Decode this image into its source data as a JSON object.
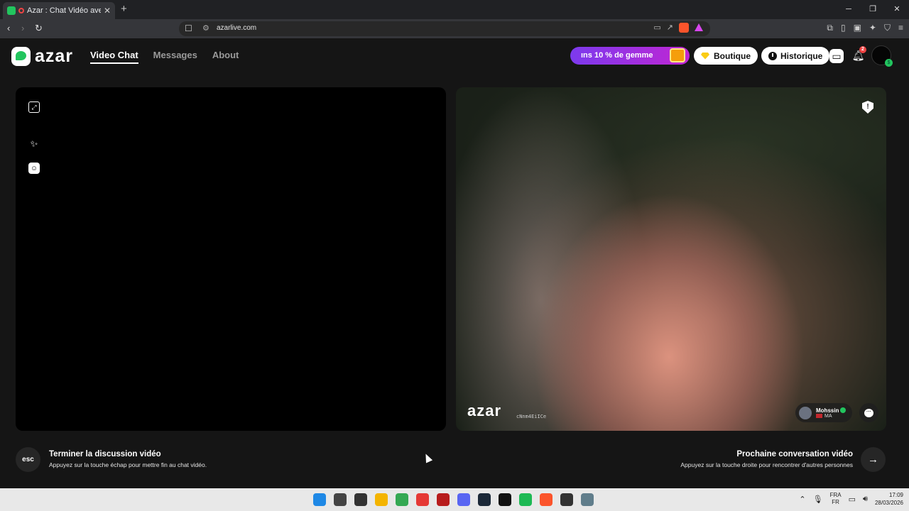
{
  "browser": {
    "tab_title": "Azar : Chat Vidéo avec de no",
    "tab_close": "✕",
    "new_tab": "+",
    "url": "azarlive.com",
    "window_controls": [
      "─",
      "❐",
      "✕"
    ]
  },
  "header": {
    "logo_text": "azar",
    "nav": [
      {
        "label": "Video Chat",
        "active": true
      },
      {
        "label": "Messages",
        "active": false
      },
      {
        "label": "About",
        "active": false
      }
    ],
    "promo_text": "ıns 10 % de gemme",
    "shop_label": "Boutique",
    "history_label": "Historique",
    "notification_count": "2",
    "avatar_badge": "$"
  },
  "remote_video": {
    "watermark": "azar",
    "watermark_id": "cNnm4EiICe",
    "user_name": "Mohssin",
    "user_country": "MA"
  },
  "controls": {
    "esc_label": "esc",
    "end_title": "Terminer la discussion vidéo",
    "end_hint": "Appuyez sur la touche échap pour mettre fin au chat vidéo.",
    "next_title": "Prochaine conversation vidéo",
    "next_hint": "Appuyez sur la touche droite pour rencontrer d'autres personnes",
    "next_arrow": "→"
  },
  "taskbar": {
    "lang_top": "FRA",
    "lang_bottom": "FR",
    "time": "17:09",
    "date": "28/03/2026",
    "app_colors": [
      "#1e88e5",
      "#444444",
      "#333333",
      "#f4b400",
      "#34a853",
      "#e53935",
      "#b71c1c",
      "#5865f2",
      "#1b2838",
      "#111111",
      "#1db954",
      "#fb542b",
      "#333333",
      "#607d8b"
    ]
  }
}
